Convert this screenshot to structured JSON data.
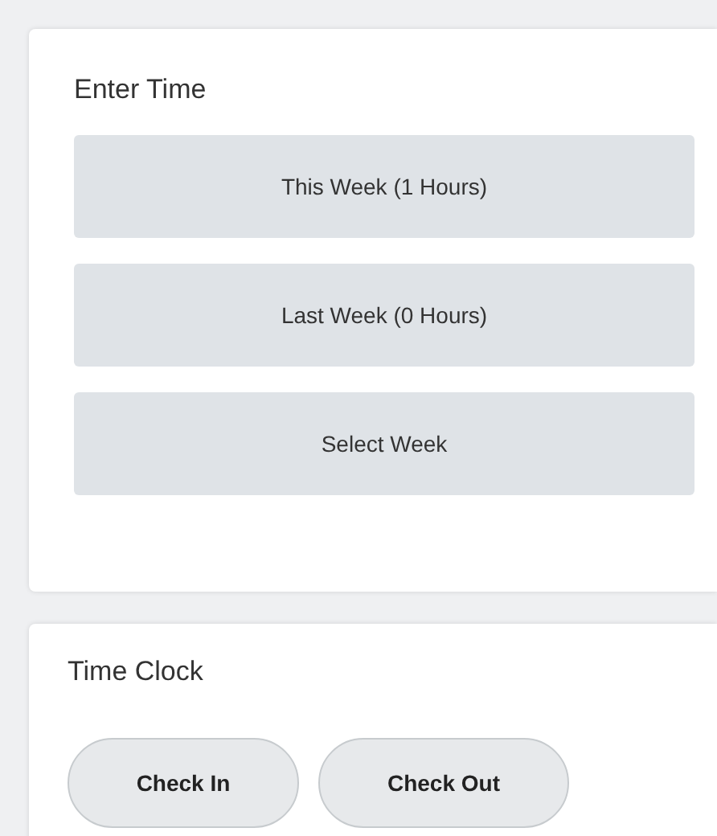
{
  "enter_time": {
    "title": "Enter Time",
    "buttons": [
      "This Week (1 Hours)",
      "Last Week (0 Hours)",
      "Select Week"
    ]
  },
  "time_clock": {
    "title": "Time Clock",
    "buttons": [
      "Check In",
      "Check Out"
    ]
  }
}
